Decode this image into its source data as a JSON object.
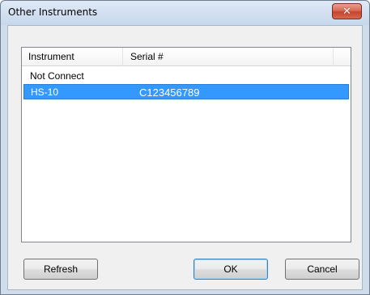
{
  "window": {
    "title": "Other Instruments",
    "close_label": "✕"
  },
  "list": {
    "columns": [
      "Instrument",
      "Serial #"
    ],
    "rows": [
      {
        "instrument": "Not Connect",
        "serial": ""
      },
      {
        "instrument": "HS-10",
        "serial": "C123456789",
        "selected": true
      }
    ]
  },
  "buttons": {
    "refresh": "Refresh",
    "ok": "OK",
    "cancel": "Cancel"
  },
  "colors": {
    "selection": "#3399ff",
    "close_button": "#c7432c"
  }
}
